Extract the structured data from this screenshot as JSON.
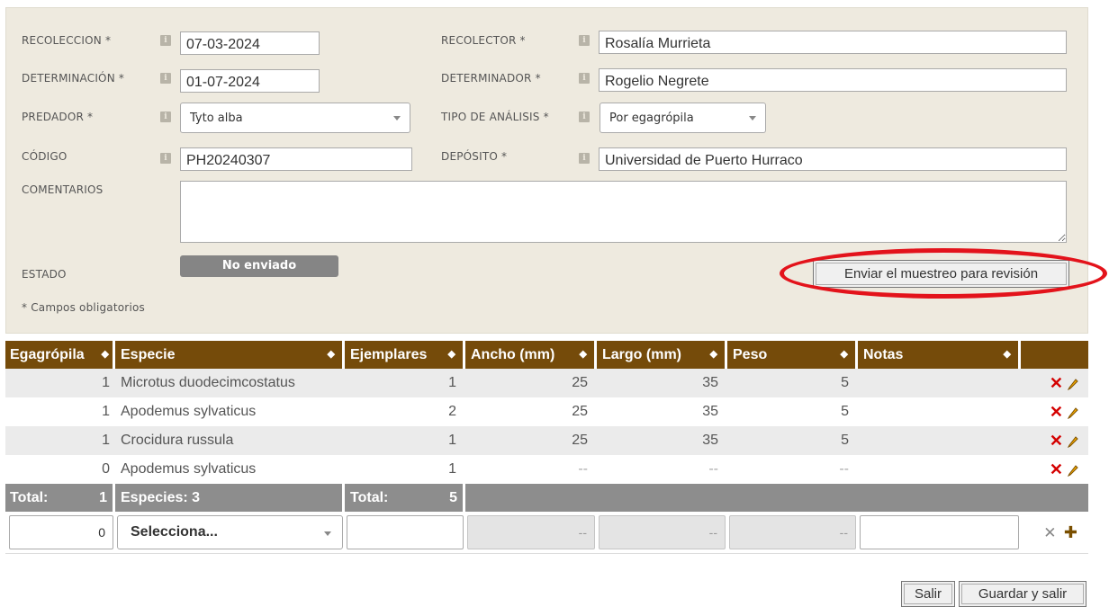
{
  "form": {
    "recoleccion": {
      "label": "RECOLECCION *",
      "value": "07-03-2024"
    },
    "recolector": {
      "label": "RECOLECTOR *",
      "value": "Rosalía Murrieta"
    },
    "determinacion": {
      "label": "DETERMINACIÓN *",
      "value": "01-07-2024"
    },
    "determinador": {
      "label": "DETERMINADOR *",
      "value": "Rogelio Negrete"
    },
    "predador": {
      "label": "PREDADOR *",
      "value": "Tyto alba"
    },
    "tipo_analisis": {
      "label": "TIPO DE ANÁLISIS *",
      "value": "Por egagrópila"
    },
    "codigo": {
      "label": "CÓDIGO",
      "value": "PH20240307"
    },
    "deposito": {
      "label": "DEPÓSITO *",
      "value": "Universidad de Puerto Hurraco"
    },
    "comentarios": {
      "label": "COMENTARIOS",
      "value": ""
    },
    "estado": {
      "label": "ESTADO",
      "value": "No enviado"
    },
    "required_note": "* Campos obligatorios",
    "info_glyph": "i",
    "submit_review_label": "Enviar el muestreo para revisión"
  },
  "table": {
    "sort_glyph": "◆",
    "columns": [
      "Egagrópila",
      "Especie",
      "Ejemplares",
      "Ancho (mm)",
      "Largo (mm)",
      "Peso",
      "Notas"
    ],
    "rows": [
      {
        "egagropila": "1",
        "especie": "Microtus duodecimcostatus",
        "ejemplares": "1",
        "ancho": "25",
        "largo": "35",
        "peso": "5",
        "notas": ""
      },
      {
        "egagropila": "1",
        "especie": "Apodemus sylvaticus",
        "ejemplares": "2",
        "ancho": "25",
        "largo": "35",
        "peso": "5",
        "notas": ""
      },
      {
        "egagropila": "1",
        "especie": "Crocidura russula",
        "ejemplares": "1",
        "ancho": "25",
        "largo": "35",
        "peso": "5",
        "notas": ""
      },
      {
        "egagropila": "0",
        "especie": "Apodemus sylvaticus",
        "ejemplares": "1",
        "ancho": "--",
        "largo": "--",
        "peso": "--",
        "notas": ""
      }
    ],
    "delete_glyph": "✕",
    "totals": {
      "total_label": "Total:",
      "egagropila_total": "1",
      "especies_label": "Especies: 3",
      "ejemplares_label": "Total:",
      "ejemplares_total": "5"
    },
    "new_row": {
      "egagropila": "0",
      "especie_placeholder": "Selecciona...",
      "ancho": "--",
      "largo": "--",
      "peso": "--",
      "clear_glyph": "✕",
      "add_glyph": "✚"
    }
  },
  "footer": {
    "exit_label": "Salir",
    "save_exit_label": "Guardar y salir"
  },
  "colors": {
    "header_brown": "#754b0a",
    "panel_beige": "#eeeadf",
    "highlight_red": "#e3131b",
    "delete_red": "#d40000"
  }
}
